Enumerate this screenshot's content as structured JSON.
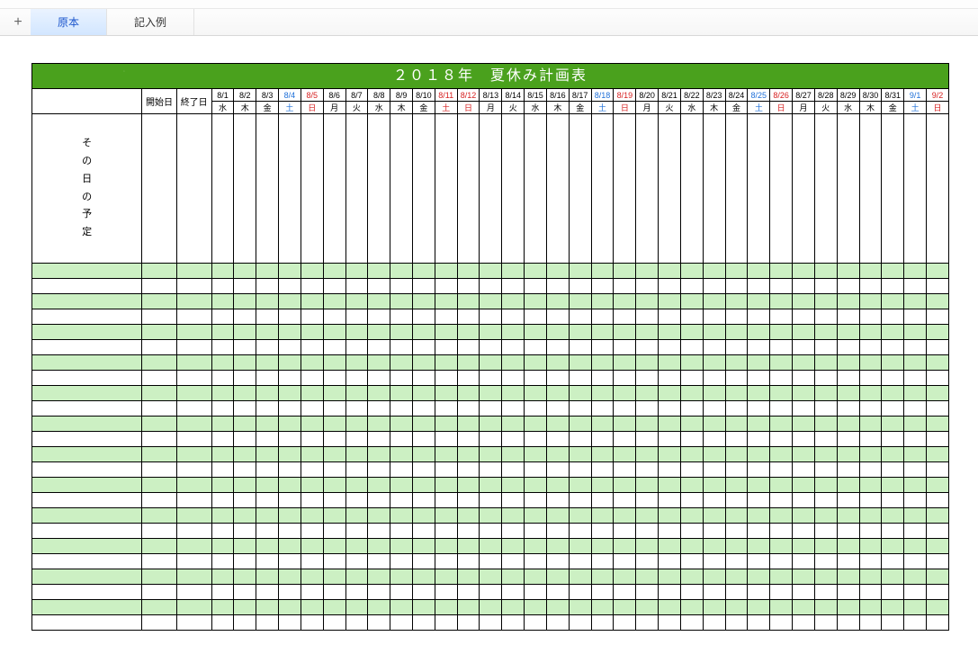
{
  "tabs": {
    "add_symbol": "+",
    "items": [
      {
        "label": "原本",
        "active": true
      },
      {
        "label": "記入例",
        "active": false
      }
    ]
  },
  "sheet": {
    "title": "２０１８年　夏休み計画表",
    "start_label": "開始日",
    "end_label": "終了日",
    "schedule_label_chars": [
      "そ",
      "の",
      "日",
      "の",
      "予",
      "定"
    ],
    "days": [
      {
        "date": "8/1",
        "dow": "水",
        "c": ""
      },
      {
        "date": "8/2",
        "dow": "木",
        "c": ""
      },
      {
        "date": "8/3",
        "dow": "金",
        "c": ""
      },
      {
        "date": "8/4",
        "dow": "土",
        "c": "b"
      },
      {
        "date": "8/5",
        "dow": "日",
        "c": "r"
      },
      {
        "date": "8/6",
        "dow": "月",
        "c": ""
      },
      {
        "date": "8/7",
        "dow": "火",
        "c": ""
      },
      {
        "date": "8/8",
        "dow": "水",
        "c": ""
      },
      {
        "date": "8/9",
        "dow": "木",
        "c": ""
      },
      {
        "date": "8/10",
        "dow": "金",
        "c": ""
      },
      {
        "date": "8/11",
        "dow": "土",
        "c": "r"
      },
      {
        "date": "8/12",
        "dow": "日",
        "c": "r"
      },
      {
        "date": "8/13",
        "dow": "月",
        "c": ""
      },
      {
        "date": "8/14",
        "dow": "火",
        "c": ""
      },
      {
        "date": "8/15",
        "dow": "水",
        "c": ""
      },
      {
        "date": "8/16",
        "dow": "木",
        "c": ""
      },
      {
        "date": "8/17",
        "dow": "金",
        "c": ""
      },
      {
        "date": "8/18",
        "dow": "土",
        "c": "b"
      },
      {
        "date": "8/19",
        "dow": "日",
        "c": "r"
      },
      {
        "date": "8/20",
        "dow": "月",
        "c": ""
      },
      {
        "date": "8/21",
        "dow": "火",
        "c": ""
      },
      {
        "date": "8/22",
        "dow": "水",
        "c": ""
      },
      {
        "date": "8/23",
        "dow": "木",
        "c": ""
      },
      {
        "date": "8/24",
        "dow": "金",
        "c": ""
      },
      {
        "date": "8/25",
        "dow": "土",
        "c": "b"
      },
      {
        "date": "8/26",
        "dow": "日",
        "c": "r"
      },
      {
        "date": "8/27",
        "dow": "月",
        "c": ""
      },
      {
        "date": "8/28",
        "dow": "火",
        "c": ""
      },
      {
        "date": "8/29",
        "dow": "水",
        "c": ""
      },
      {
        "date": "8/30",
        "dow": "木",
        "c": ""
      },
      {
        "date": "8/31",
        "dow": "金",
        "c": ""
      },
      {
        "date": "9/1",
        "dow": "土",
        "c": "b"
      },
      {
        "date": "9/2",
        "dow": "日",
        "c": "r"
      }
    ],
    "data_row_count": 24
  }
}
